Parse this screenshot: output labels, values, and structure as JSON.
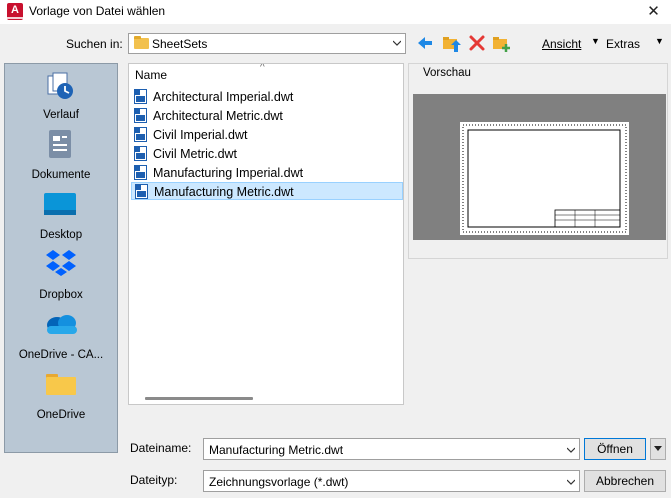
{
  "window": {
    "title": "Vorlage von Datei wählen",
    "app_icon_letter": "A",
    "close_glyph": "✕"
  },
  "lookin": {
    "label": "Suchen in:",
    "value": "SheetSets"
  },
  "toolbar": {
    "icons": [
      "back-arrow-icon",
      "up-folder-icon",
      "delete-icon",
      "new-folder-icon"
    ],
    "view_label": "Ansicht",
    "tools_label": "Extras",
    "caret_glyph": "▼"
  },
  "places": [
    {
      "label": "Verlauf",
      "icon": "history-icon"
    },
    {
      "label": "Dokumente",
      "icon": "documents-icon"
    },
    {
      "label": "Desktop",
      "icon": "desktop-icon"
    },
    {
      "label": "Dropbox",
      "icon": "dropbox-icon"
    },
    {
      "label": "OneDrive - CA...",
      "icon": "onedrive-cloud-icon"
    },
    {
      "label": "OneDrive",
      "icon": "onedrive-folder-icon"
    }
  ],
  "filelist": {
    "column_name": "Name",
    "sort_glyph": "^",
    "files": [
      "Architectural Imperial.dwt",
      "Architectural Metric.dwt",
      "Civil Imperial.dwt",
      "Civil Metric.dwt",
      "Manufacturing Imperial.dwt",
      "Manufacturing Metric.dwt"
    ],
    "selected_index": 5
  },
  "preview": {
    "label": "Vorschau"
  },
  "filename": {
    "label": "Dateiname:",
    "value": "Manufacturing Metric.dwt"
  },
  "filetype": {
    "label": "Dateityp:",
    "value": "Zeichnungsvorlage (*.dwt)"
  },
  "buttons": {
    "open": "Öffnen",
    "cancel": "Abbrechen"
  },
  "colors": {
    "places_bg": "#b9c7d4",
    "selection_bg": "#cce8ff",
    "accent": "#0078d7",
    "autocad_red": "#c8102e"
  }
}
